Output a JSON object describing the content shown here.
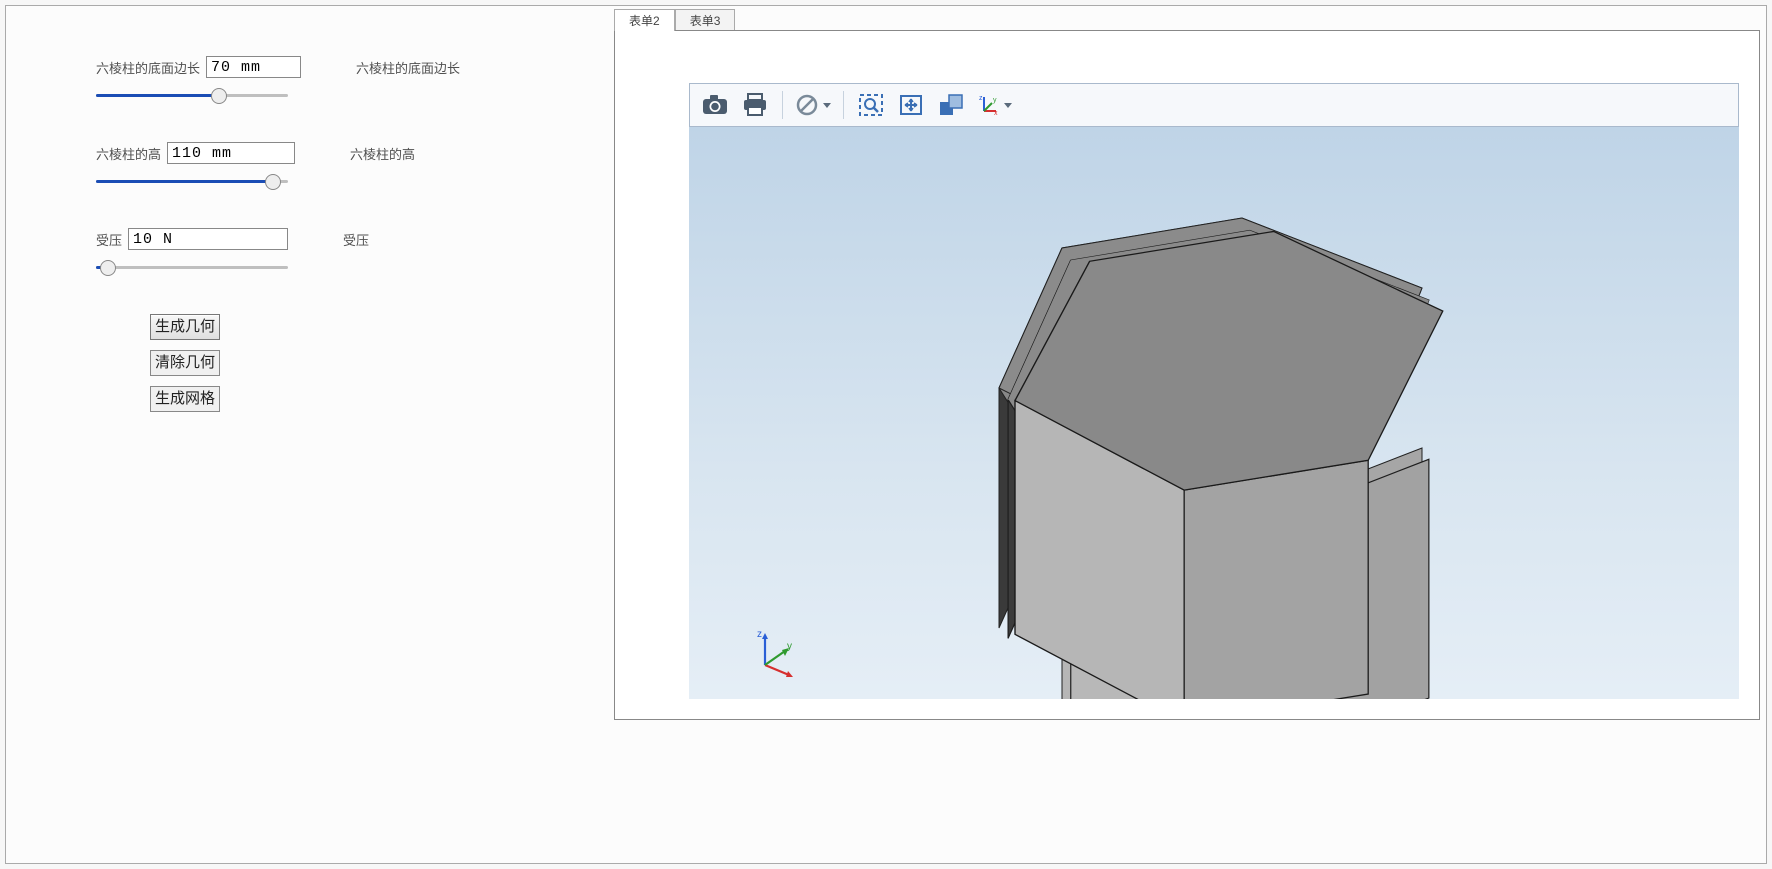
{
  "params": {
    "edge": {
      "label": "六棱柱的底面边长",
      "value": "70 mm",
      "right_label": "六棱柱的底面边长",
      "slider_fill_pct": 64,
      "slider_thumb_pct": 64
    },
    "height": {
      "label": "六棱柱的高",
      "value": "110 mm",
      "right_label": "六棱柱的高",
      "slider_fill_pct": 92,
      "slider_thumb_pct": 92
    },
    "pressure": {
      "label": "受压",
      "value": "10 N",
      "right_label": "受压",
      "slider_fill_pct": 6,
      "slider_thumb_pct": 6
    }
  },
  "buttons": {
    "gen_geometry": "生成几何",
    "clear_geometry": "清除几何",
    "gen_mesh": "生成网格"
  },
  "tabs": {
    "tab2": "表单2",
    "tab3": "表单3"
  },
  "toolbar_icons": {
    "camera": "camera-icon",
    "print": "print-icon",
    "stop": "no-entry-icon",
    "zoom_box": "zoom-box-icon",
    "fit": "fit-view-icon",
    "transparency": "transparency-icon",
    "axes": "axes-icon"
  },
  "axes": {
    "x": "x",
    "y": "y",
    "z": "z"
  },
  "colors": {
    "accent": "#1b4db5",
    "axis_x": "#d62f2f",
    "axis_y": "#2f9a2f",
    "axis_z": "#2a5fd6",
    "hex_top": "#8c8c8c",
    "hex_front": "#b9b9b9",
    "hex_side_dark": "#3d3d3d",
    "hex_side_mid": "#a4a4a4"
  }
}
